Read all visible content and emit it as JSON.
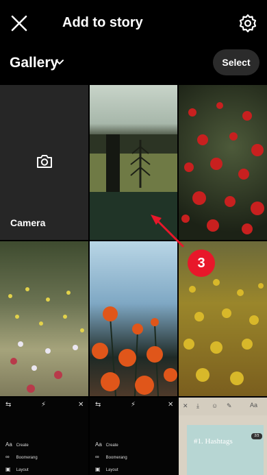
{
  "header": {
    "title": "Add to story",
    "close_icon": "close-icon",
    "settings_icon": "gear-icon"
  },
  "gallery": {
    "label": "Gallery",
    "select_label": "Select"
  },
  "tiles": {
    "camera_label": "Camera",
    "camera_icon": "camera-icon"
  },
  "story_menu": {
    "create": "Create",
    "boomerang": "Boomerang",
    "layout": "Layout",
    "aa": "Aa"
  },
  "hashtag": {
    "text": "#1. Hashtags",
    "pill": "2/3"
  },
  "annotation": {
    "step": "3",
    "color": "#e8172a"
  }
}
